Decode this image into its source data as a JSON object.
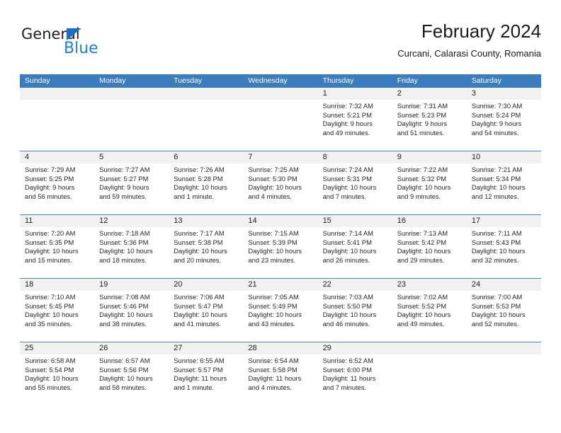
{
  "logo": {
    "word1": "General",
    "word2": "Blue",
    "triangle_color": "#1b6ec2",
    "word1_color": "#231f20",
    "word2_color": "#1b7fd4"
  },
  "header": {
    "title": "February 2024",
    "subtitle": "Curcani, Calarasi County, Romania"
  },
  "theme": {
    "header_blue": "#3a7cbe",
    "row_divider": "#4a87c6",
    "daynum_band": "#f1f1f1"
  },
  "weekdays": [
    "Sunday",
    "Monday",
    "Tuesday",
    "Wednesday",
    "Thursday",
    "Friday",
    "Saturday"
  ],
  "weeks": [
    [
      {
        "day": "",
        "sunrise": "",
        "sunset": "",
        "daylight_line1": "",
        "daylight_line2": ""
      },
      {
        "day": "",
        "sunrise": "",
        "sunset": "",
        "daylight_line1": "",
        "daylight_line2": ""
      },
      {
        "day": "",
        "sunrise": "",
        "sunset": "",
        "daylight_line1": "",
        "daylight_line2": ""
      },
      {
        "day": "",
        "sunrise": "",
        "sunset": "",
        "daylight_line1": "",
        "daylight_line2": ""
      },
      {
        "day": "1",
        "sunrise": "Sunrise: 7:32 AM",
        "sunset": "Sunset: 5:21 PM",
        "daylight_line1": "Daylight: 9 hours",
        "daylight_line2": "and 49 minutes."
      },
      {
        "day": "2",
        "sunrise": "Sunrise: 7:31 AM",
        "sunset": "Sunset: 5:23 PM",
        "daylight_line1": "Daylight: 9 hours",
        "daylight_line2": "and 51 minutes."
      },
      {
        "day": "3",
        "sunrise": "Sunrise: 7:30 AM",
        "sunset": "Sunset: 5:24 PM",
        "daylight_line1": "Daylight: 9 hours",
        "daylight_line2": "and 54 minutes."
      }
    ],
    [
      {
        "day": "4",
        "sunrise": "Sunrise: 7:29 AM",
        "sunset": "Sunset: 5:25 PM",
        "daylight_line1": "Daylight: 9 hours",
        "daylight_line2": "and 56 minutes."
      },
      {
        "day": "5",
        "sunrise": "Sunrise: 7:27 AM",
        "sunset": "Sunset: 5:27 PM",
        "daylight_line1": "Daylight: 9 hours",
        "daylight_line2": "and 59 minutes."
      },
      {
        "day": "6",
        "sunrise": "Sunrise: 7:26 AM",
        "sunset": "Sunset: 5:28 PM",
        "daylight_line1": "Daylight: 10 hours",
        "daylight_line2": "and 1 minute."
      },
      {
        "day": "7",
        "sunrise": "Sunrise: 7:25 AM",
        "sunset": "Sunset: 5:30 PM",
        "daylight_line1": "Daylight: 10 hours",
        "daylight_line2": "and 4 minutes."
      },
      {
        "day": "8",
        "sunrise": "Sunrise: 7:24 AM",
        "sunset": "Sunset: 5:31 PM",
        "daylight_line1": "Daylight: 10 hours",
        "daylight_line2": "and 7 minutes."
      },
      {
        "day": "9",
        "sunrise": "Sunrise: 7:22 AM",
        "sunset": "Sunset: 5:32 PM",
        "daylight_line1": "Daylight: 10 hours",
        "daylight_line2": "and 9 minutes."
      },
      {
        "day": "10",
        "sunrise": "Sunrise: 7:21 AM",
        "sunset": "Sunset: 5:34 PM",
        "daylight_line1": "Daylight: 10 hours",
        "daylight_line2": "and 12 minutes."
      }
    ],
    [
      {
        "day": "11",
        "sunrise": "Sunrise: 7:20 AM",
        "sunset": "Sunset: 5:35 PM",
        "daylight_line1": "Daylight: 10 hours",
        "daylight_line2": "and 15 minutes."
      },
      {
        "day": "12",
        "sunrise": "Sunrise: 7:18 AM",
        "sunset": "Sunset: 5:36 PM",
        "daylight_line1": "Daylight: 10 hours",
        "daylight_line2": "and 18 minutes."
      },
      {
        "day": "13",
        "sunrise": "Sunrise: 7:17 AM",
        "sunset": "Sunset: 5:38 PM",
        "daylight_line1": "Daylight: 10 hours",
        "daylight_line2": "and 20 minutes."
      },
      {
        "day": "14",
        "sunrise": "Sunrise: 7:15 AM",
        "sunset": "Sunset: 5:39 PM",
        "daylight_line1": "Daylight: 10 hours",
        "daylight_line2": "and 23 minutes."
      },
      {
        "day": "15",
        "sunrise": "Sunrise: 7:14 AM",
        "sunset": "Sunset: 5:41 PM",
        "daylight_line1": "Daylight: 10 hours",
        "daylight_line2": "and 26 minutes."
      },
      {
        "day": "16",
        "sunrise": "Sunrise: 7:13 AM",
        "sunset": "Sunset: 5:42 PM",
        "daylight_line1": "Daylight: 10 hours",
        "daylight_line2": "and 29 minutes."
      },
      {
        "day": "17",
        "sunrise": "Sunrise: 7:11 AM",
        "sunset": "Sunset: 5:43 PM",
        "daylight_line1": "Daylight: 10 hours",
        "daylight_line2": "and 32 minutes."
      }
    ],
    [
      {
        "day": "18",
        "sunrise": "Sunrise: 7:10 AM",
        "sunset": "Sunset: 5:45 PM",
        "daylight_line1": "Daylight: 10 hours",
        "daylight_line2": "and 35 minutes."
      },
      {
        "day": "19",
        "sunrise": "Sunrise: 7:08 AM",
        "sunset": "Sunset: 5:46 PM",
        "daylight_line1": "Daylight: 10 hours",
        "daylight_line2": "and 38 minutes."
      },
      {
        "day": "20",
        "sunrise": "Sunrise: 7:06 AM",
        "sunset": "Sunset: 5:47 PM",
        "daylight_line1": "Daylight: 10 hours",
        "daylight_line2": "and 41 minutes."
      },
      {
        "day": "21",
        "sunrise": "Sunrise: 7:05 AM",
        "sunset": "Sunset: 5:49 PM",
        "daylight_line1": "Daylight: 10 hours",
        "daylight_line2": "and 43 minutes."
      },
      {
        "day": "22",
        "sunrise": "Sunrise: 7:03 AM",
        "sunset": "Sunset: 5:50 PM",
        "daylight_line1": "Daylight: 10 hours",
        "daylight_line2": "and 46 minutes."
      },
      {
        "day": "23",
        "sunrise": "Sunrise: 7:02 AM",
        "sunset": "Sunset: 5:52 PM",
        "daylight_line1": "Daylight: 10 hours",
        "daylight_line2": "and 49 minutes."
      },
      {
        "day": "24",
        "sunrise": "Sunrise: 7:00 AM",
        "sunset": "Sunset: 5:53 PM",
        "daylight_line1": "Daylight: 10 hours",
        "daylight_line2": "and 52 minutes."
      }
    ],
    [
      {
        "day": "25",
        "sunrise": "Sunrise: 6:58 AM",
        "sunset": "Sunset: 5:54 PM",
        "daylight_line1": "Daylight: 10 hours",
        "daylight_line2": "and 55 minutes."
      },
      {
        "day": "26",
        "sunrise": "Sunrise: 6:57 AM",
        "sunset": "Sunset: 5:56 PM",
        "daylight_line1": "Daylight: 10 hours",
        "daylight_line2": "and 58 minutes."
      },
      {
        "day": "27",
        "sunrise": "Sunrise: 6:55 AM",
        "sunset": "Sunset: 5:57 PM",
        "daylight_line1": "Daylight: 11 hours",
        "daylight_line2": "and 1 minute."
      },
      {
        "day": "28",
        "sunrise": "Sunrise: 6:54 AM",
        "sunset": "Sunset: 5:58 PM",
        "daylight_line1": "Daylight: 11 hours",
        "daylight_line2": "and 4 minutes."
      },
      {
        "day": "29",
        "sunrise": "Sunrise: 6:52 AM",
        "sunset": "Sunset: 6:00 PM",
        "daylight_line1": "Daylight: 11 hours",
        "daylight_line2": "and 7 minutes."
      },
      {
        "day": "",
        "sunrise": "",
        "sunset": "",
        "daylight_line1": "",
        "daylight_line2": ""
      },
      {
        "day": "",
        "sunrise": "",
        "sunset": "",
        "daylight_line1": "",
        "daylight_line2": ""
      }
    ]
  ]
}
